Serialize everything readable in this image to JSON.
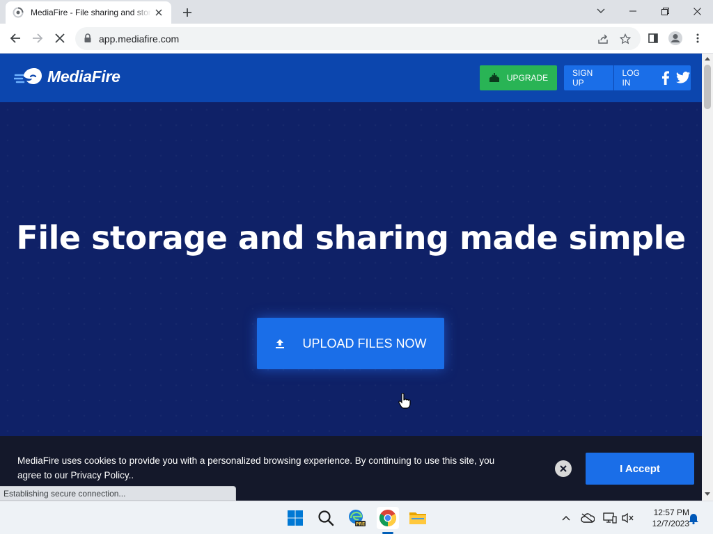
{
  "browser": {
    "tab_title": "MediaFire - File sharing and storage",
    "url": "app.mediafire.com",
    "status_text": "Establishing secure connection..."
  },
  "site": {
    "logo_text": "MediaFire",
    "upgrade_label": "UPGRADE",
    "signup_label": "SIGN UP",
    "login_label": "LOG IN",
    "hero_title": "File storage and sharing made simple",
    "upload_label": "UPLOAD FILES NOW"
  },
  "cookie": {
    "message": "MediaFire uses cookies to provide you with a personalized browsing experience. By continuing to use this site, you agree to our Privacy Policy..",
    "accept_label": "I Accept"
  },
  "taskbar": {
    "time": "12:57 PM",
    "date": "12/7/2023",
    "apps": [
      "start-icon",
      "search-icon",
      "edge-beta-icon",
      "chrome-icon",
      "file-explorer-icon"
    ]
  },
  "colors": {
    "header_blue": "#0c46ae",
    "hero_navy": "#0f2167",
    "button_blue": "#1a6ee8",
    "upgrade_green": "#29b455",
    "cookie_bg": "#14182a"
  }
}
